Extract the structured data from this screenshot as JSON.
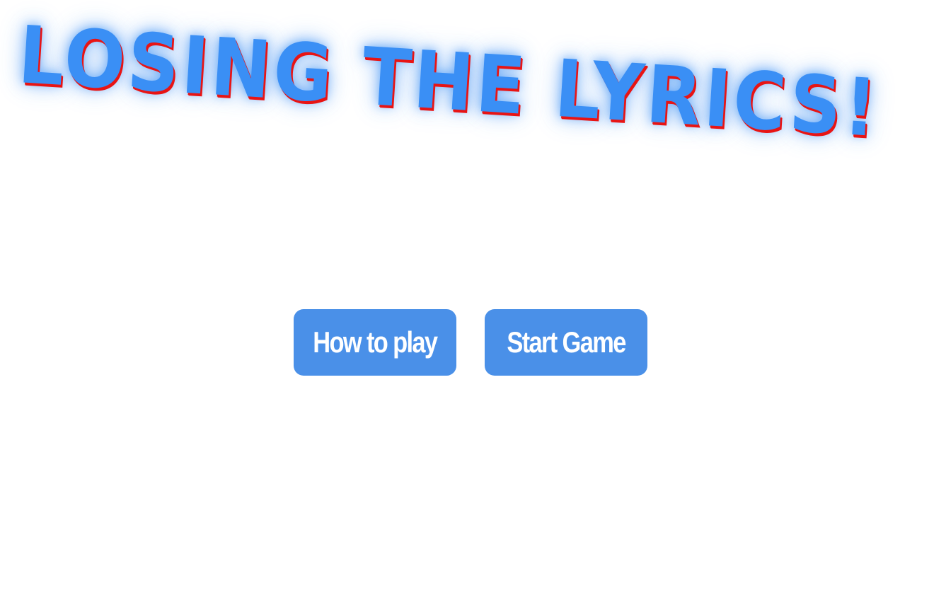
{
  "title": {
    "text": "LOSING THE LYRICS!"
  },
  "menu": {
    "how_to_play_label": "How to play",
    "start_game_label": "Start Game"
  },
  "colors": {
    "title_fill": "#3a8ff5",
    "title_shadow": "#e81414",
    "title_glow": "#3a8ff5",
    "button_bg": "#4a90e8",
    "button_text": "#ffffff",
    "background": "#ffffff"
  }
}
